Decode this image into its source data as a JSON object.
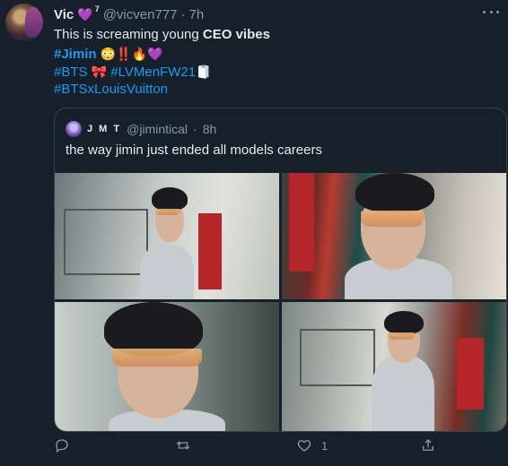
{
  "tweet": {
    "display_name": "Vic",
    "heart": "💜",
    "sup": "7",
    "handle": "@vicven777",
    "separator": "·",
    "time": "7h",
    "line1_pre": "This is screaming young ",
    "line1_bold": "CEO vibes",
    "line2_tag": "#Jimin",
    "line2_emoji": "😳‼️🔥💜",
    "line3_tag1": "#BTS",
    "line3_emoji1": "🎀",
    "line3_tag2": "#LVMenFW21",
    "line3_emoji2": "🧻",
    "line4_tag": "#BTSxLouisVuitton"
  },
  "quoted": {
    "display_name": "J M T",
    "handle": "@jimintical",
    "separator": "·",
    "time": "8h",
    "text": "the way jimin just ended all models careers"
  },
  "actions": {
    "reply_count": "",
    "retweet_count": "",
    "like_count": "1",
    "share_count": ""
  },
  "icons": {
    "reply": "reply-icon",
    "retweet": "retweet-icon",
    "like": "heart-icon",
    "share": "share-icon",
    "more": "more-icon"
  },
  "colors": {
    "background": "#15202b",
    "text": "#e7e9ea",
    "muted": "#8b98a5",
    "link": "#1d9bf0",
    "border": "#38444d"
  }
}
